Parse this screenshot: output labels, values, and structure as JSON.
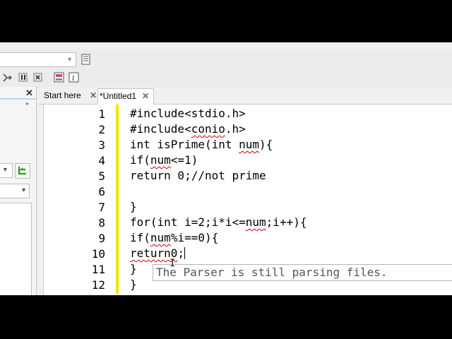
{
  "tabs": [
    {
      "label": "Start here",
      "close": "✕"
    },
    {
      "label": "*Untitled1",
      "close": "✕"
    }
  ],
  "left_panel": {
    "close": "✕"
  },
  "editor": {
    "line_numbers": [
      "1",
      "2",
      "3",
      "4",
      "5",
      "6",
      "7",
      "8",
      "9",
      "10",
      "11",
      "12"
    ],
    "lines": {
      "l1": "#include<stdio.h>",
      "l2a": "#include<",
      "l2b": "conio",
      "l2c": ".h>",
      "l3a": "int ",
      "l3b": "isPrime",
      "l3c": "(int ",
      "l3d": "num",
      "l3e": "){",
      "l4a": "if(",
      "l4b": "num",
      "l4c": "<=1)",
      "l5": "return 0;//not prime",
      "l6": "",
      "l7": "}",
      "l8a": "for(int i=2;i*i<=",
      "l8b": "num",
      "l8c": ";i++){",
      "l9a": "if(",
      "l9b": "num",
      "l9c": "%i==0){",
      "l10a": "return0",
      "l10b": ";",
      "l11": "}",
      "l12": "}"
    },
    "tooltip": "The Parser is still parsing files."
  },
  "colors": {
    "change_bar": "#f2e300",
    "squiggle": "#d00000"
  }
}
